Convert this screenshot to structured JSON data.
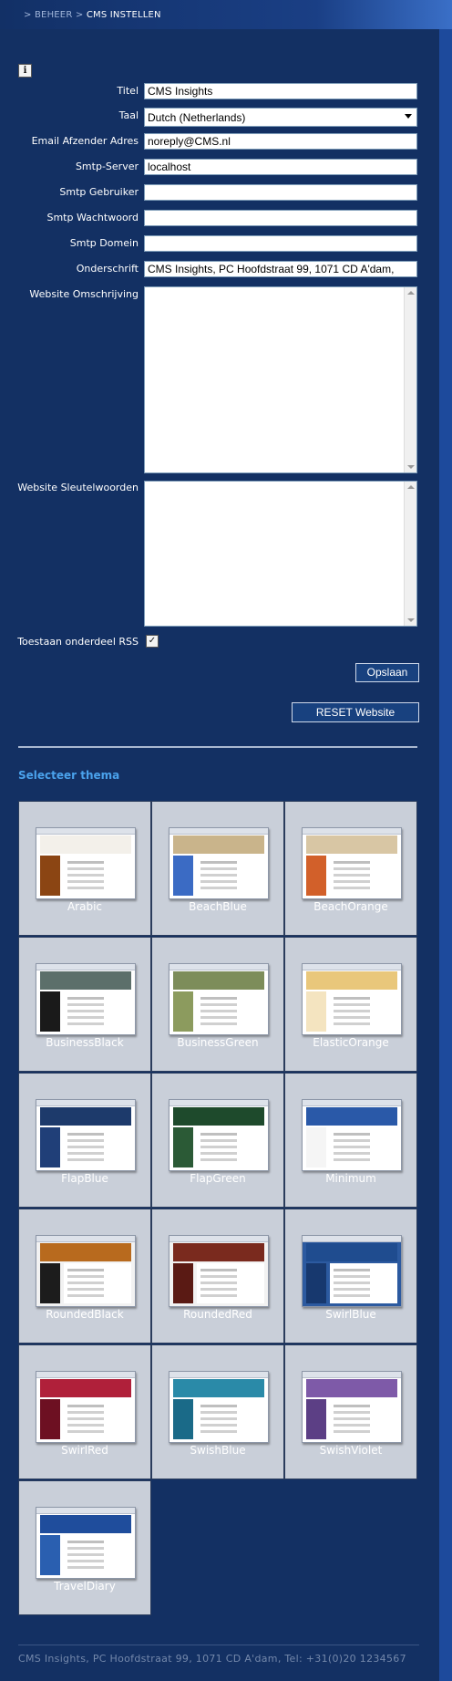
{
  "breadcrumb": {
    "sep": ">",
    "parent": "BEHEER",
    "current": "CMS INSTELLEN"
  },
  "form": {
    "titel_label": "Titel",
    "titel_value": "CMS Insights",
    "taal_label": "Taal",
    "taal_value": "Dutch (Netherlands)",
    "email_label": "Email Afzender Adres",
    "email_value": "noreply@CMS.nl",
    "smtp_server_label": "Smtp-Server",
    "smtp_server_value": "localhost",
    "smtp_gebruiker_label": "Smtp Gebruiker",
    "smtp_gebruiker_value": "",
    "smtp_wachtwoord_label": "Smtp Wachtwoord",
    "smtp_wachtwoord_value": "",
    "smtp_domein_label": "Smtp Domein",
    "smtp_domein_value": "",
    "onderschrift_label": "Onderschrift",
    "onderschrift_value": "CMS Insights, PC Hoofdstraat 99, 1071 CD A'dam,",
    "omschrijving_label": "Website Omschrijving",
    "sleutelwoorden_label": "Website Sleutelwoorden",
    "rss_label": "Toestaan onderdeel RSS",
    "rss_checked": true
  },
  "buttons": {
    "opslaan": "Opslaan",
    "reset": "RESET Website"
  },
  "theme_section": {
    "title": "Selecteer thema",
    "themes": [
      {
        "name": "Arabic",
        "header": "#f3f0ea",
        "sidebar": "#8b4513",
        "content": "#ffffff"
      },
      {
        "name": "BeachBlue",
        "header": "#c9b48b",
        "sidebar": "#3b6bc4",
        "content": "#ffffff"
      },
      {
        "name": "BeachOrange",
        "header": "#d8c6a4",
        "sidebar": "#d2602a",
        "content": "#ffffff"
      },
      {
        "name": "BusinessBlack",
        "header": "#5c6f6a",
        "sidebar": "#1a1a1a",
        "content": "#ffffff"
      },
      {
        "name": "BusinessGreen",
        "header": "#7d8d5a",
        "sidebar": "#8c9b5e",
        "content": "#ffffff"
      },
      {
        "name": "ElasticOrange",
        "header": "#e9c77b",
        "sidebar": "#f4e4c0",
        "content": "#ffffff"
      },
      {
        "name": "FlapBlue",
        "header": "#1d3a6b",
        "sidebar": "#203f78",
        "content": "#ffffff"
      },
      {
        "name": "FlapGreen",
        "header": "#1e4a2c",
        "sidebar": "#2b5a36",
        "content": "#ffffff"
      },
      {
        "name": "Minimum",
        "header": "#2a59a8",
        "sidebar": "#f5f5f5",
        "content": "#ffffff"
      },
      {
        "name": "RoundedBlack",
        "header": "#b86a1e",
        "sidebar": "#1c1c1c",
        "content": "#f2f2f2"
      },
      {
        "name": "RoundedRed",
        "header": "#7a2a1e",
        "sidebar": "#5a1a14",
        "content": "#f2f2f2"
      },
      {
        "name": "SwirlBlue",
        "header": "#1f4c8f",
        "sidebar": "#17386e",
        "content": "#2c5aa0"
      },
      {
        "name": "SwirlRed",
        "header": "#b0203a",
        "sidebar": "#6d1022",
        "content": "#ffffff"
      },
      {
        "name": "SwishBlue",
        "header": "#2a8aa8",
        "sidebar": "#1a6a88",
        "content": "#ffffff"
      },
      {
        "name": "SwishViolet",
        "header": "#7e5aa8",
        "sidebar": "#5c3f85",
        "content": "#ffffff"
      },
      {
        "name": "TravelDiary",
        "header": "#1f4d9c",
        "sidebar": "#2a5fb0",
        "content": "#ffffff"
      }
    ]
  },
  "footer": {
    "text": "CMS Insights, PC Hoofdstraat 99, 1071 CD A'dam, Tel: +31(0)20 1234567"
  }
}
